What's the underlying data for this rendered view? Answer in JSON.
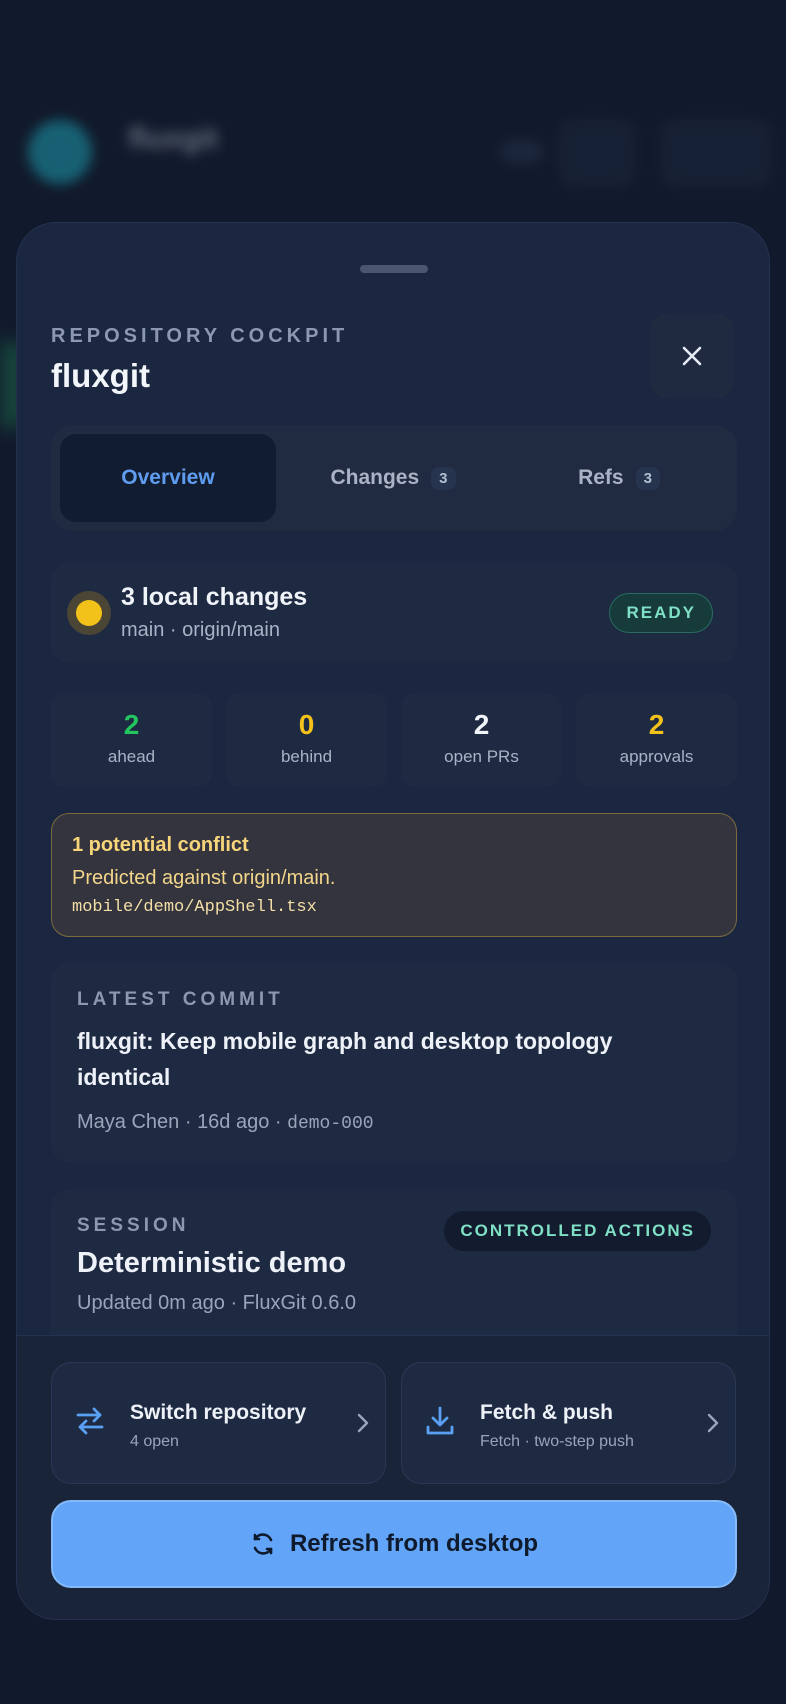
{
  "header": {
    "eyebrow": "REPOSITORY COCKPIT",
    "title": "fluxgit"
  },
  "tabs": [
    {
      "label": "Overview",
      "count": ""
    },
    {
      "label": "Changes",
      "count": "3"
    },
    {
      "label": "Refs",
      "count": "3"
    }
  ],
  "status": {
    "title": "3 local changes",
    "subtitle": "main · origin/main",
    "badge": "READY",
    "dot_color": "#f3c21a"
  },
  "stats": [
    {
      "value": "2",
      "label": "ahead",
      "color": "#22c55e"
    },
    {
      "value": "0",
      "label": "behind",
      "color": "#f3c21a"
    },
    {
      "value": "2",
      "label": "open PRs",
      "color": "#f0f3f8"
    },
    {
      "value": "2",
      "label": "approvals",
      "color": "#f3c21a"
    }
  ],
  "conflict": {
    "heading": "1 potential conflict",
    "text": "Predicted against origin/main.",
    "file": "mobile/demo/AppShell.tsx"
  },
  "latest_commit": {
    "eyebrow": "LATEST COMMIT",
    "message": "fluxgit: Keep mobile graph and desktop topology identical",
    "author": "Maya Chen",
    "age": "16d ago",
    "hash": "demo-000"
  },
  "session": {
    "eyebrow": "SESSION",
    "name": "Deterministic demo",
    "meta": "Updated 0m ago · FluxGit 0.6.0",
    "badge": "CONTROLLED ACTIONS"
  },
  "actions": {
    "switch": {
      "title": "Switch repository",
      "subtitle": "4 open",
      "icon": "switch-arrows-icon"
    },
    "fetch": {
      "title": "Fetch & push",
      "subtitle": "Fetch · two-step push",
      "icon": "download-icon"
    }
  },
  "refresh_label": "Refresh from desktop",
  "colors": {
    "accent": "#62a4f7",
    "teal": "#7fe0c6",
    "warning": "#f8d57a"
  }
}
